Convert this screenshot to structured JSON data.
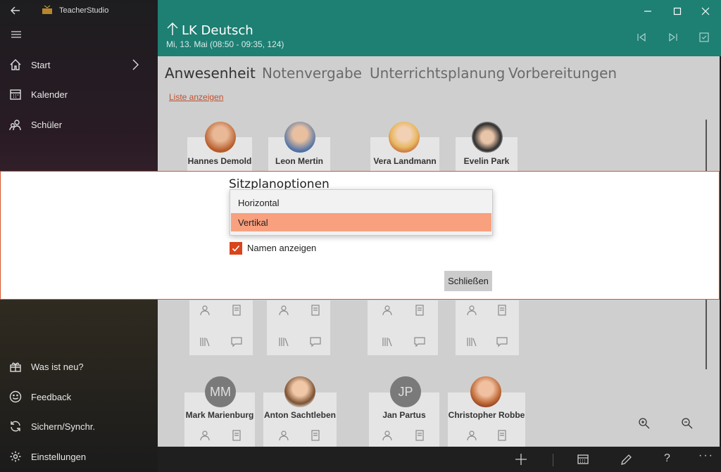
{
  "app": {
    "name": "TeacherStudio"
  },
  "sidebar": {
    "items": [
      {
        "label": "Start"
      },
      {
        "label": "Kalender"
      },
      {
        "label": "Schüler"
      }
    ],
    "bottom_items": [
      {
        "label": "Was ist neu?"
      },
      {
        "label": "Feedback"
      },
      {
        "label": "Sichern/Synchr."
      },
      {
        "label": "Einstellungen"
      }
    ]
  },
  "header": {
    "title": "LK Deutsch",
    "subtitle": "Mi, 13. Mai (08:50 - 09:35, 124)"
  },
  "tabs": [
    {
      "label": "Anwesenheit"
    },
    {
      "label": "Notenvergabe"
    },
    {
      "label": "Unterrichtsplanung"
    },
    {
      "label": "Vorbereitungen"
    }
  ],
  "list_link": "Liste anzeigen",
  "students_row1": [
    {
      "name": "Hannes Demold"
    },
    {
      "name": "Leon Mertin"
    },
    {
      "name": "Vera Landmann"
    },
    {
      "name": "Evelin Park"
    }
  ],
  "students_row2": [
    {
      "name": "Mark Marienburg",
      "initials": "MM"
    },
    {
      "name": "Anton Sachtleben"
    },
    {
      "name": "Jan Partus",
      "initials": "JP"
    },
    {
      "name": "Christopher Robbe"
    }
  ],
  "dialog": {
    "title": "Sitzplanoptionen",
    "options": [
      "Horizontal",
      "Vertikal"
    ],
    "selected": "Vertikal",
    "checkbox_label": "Namen anzeigen",
    "checkbox_checked": true,
    "close_label": "Schließen"
  },
  "colors": {
    "header": "#1e7f73",
    "accent": "#d8441c",
    "selected_option": "#f9a07f"
  }
}
